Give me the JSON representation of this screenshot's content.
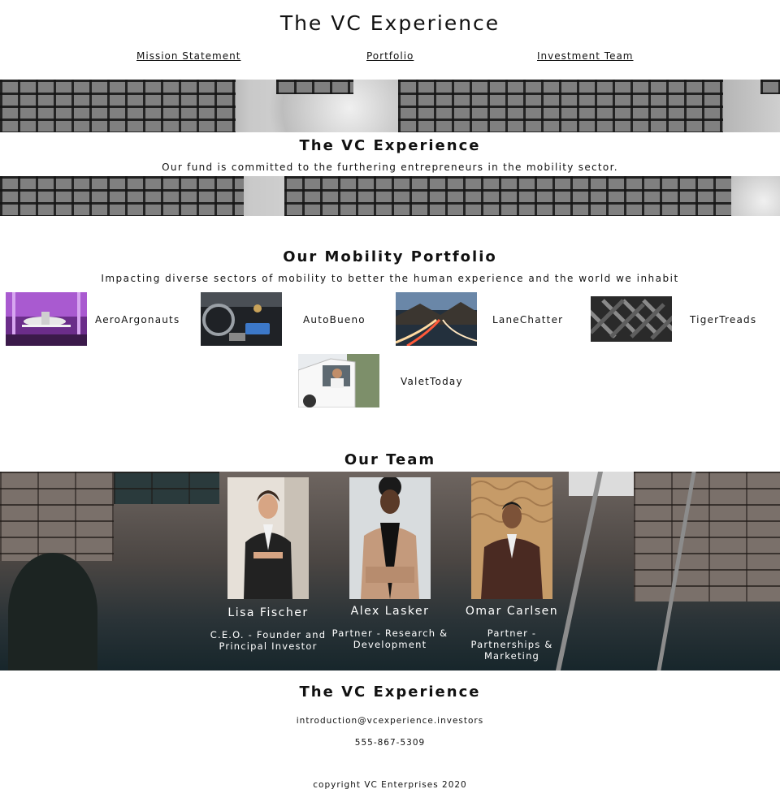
{
  "header": {
    "title": "The VC Experience",
    "nav": [
      "Mission Statement",
      "Portfolio",
      "Investment Team"
    ]
  },
  "hero": {
    "title": "The VC Experience",
    "text": "Our fund is committed to the furthering entrepreneurs in the mobility sector."
  },
  "portfolio": {
    "title": "Our Mobility Portfolio",
    "subtitle": "Impacting diverse sectors of mobility to better the human experience and the world we inhabit",
    "items": [
      {
        "name": "AeroArgonauts"
      },
      {
        "name": "AutoBueno"
      },
      {
        "name": "LaneChatter"
      },
      {
        "name": "TigerTreads"
      },
      {
        "name": "ValetToday"
      }
    ]
  },
  "team": {
    "title": "Our Team",
    "members": [
      {
        "name": "Lisa Fischer",
        "role": "C.E.O. - Founder and Principal Investor"
      },
      {
        "name": "Alex Lasker",
        "role": "Partner - Research & Development"
      },
      {
        "name": "Omar Carlsen",
        "role": "Partner - Partnerships & Marketing"
      }
    ]
  },
  "footer": {
    "title": "The VC Experience",
    "email": "introduction@vcexperience.investors",
    "phone": "555-867-5309",
    "copyright": "copyright VC Enterprises 2020"
  }
}
